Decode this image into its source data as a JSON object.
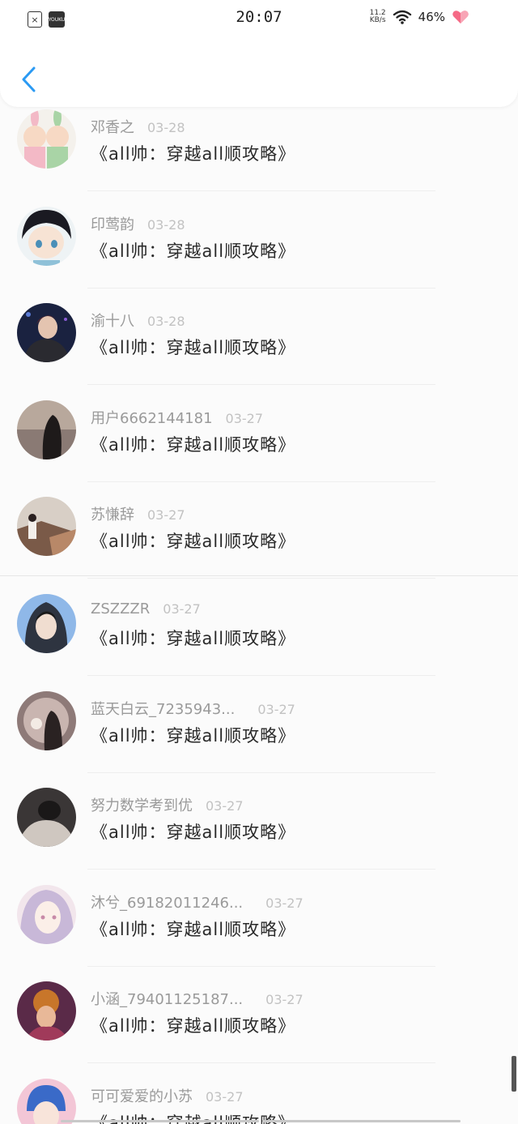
{
  "status_bar": {
    "time": "20:07",
    "net_speed_value": "11.2",
    "net_speed_unit": "KB/s",
    "battery": "46%",
    "youku_label": "YOUKU",
    "sim_glyph": "×"
  },
  "header": {
    "back_icon": "chevron-left-icon",
    "accent_color": "#2b9af3"
  },
  "comments": [
    {
      "user": "邓香之",
      "date": "03-28",
      "text": "《all帅：穿越all顺攻略》"
    },
    {
      "user": "印莺韵",
      "date": "03-28",
      "text": "《all帅：穿越all顺攻略》"
    },
    {
      "user": "渝十八",
      "date": "03-28",
      "text": "《all帅：穿越all顺攻略》"
    },
    {
      "user": "用户6662144181",
      "date": "03-27",
      "text": "《all帅：穿越all顺攻略》"
    },
    {
      "user": "苏慊辞",
      "date": "03-27",
      "text": "《all帅：穿越all顺攻略》"
    },
    {
      "user": "ZSZZZR",
      "date": "03-27",
      "text": "《all帅：穿越all顺攻略》"
    },
    {
      "user": "蓝天白云_7235943...",
      "date": "03-27",
      "text": "《all帅：穿越all顺攻略》"
    },
    {
      "user": "努力数学考到优",
      "date": "03-27",
      "text": "《all帅：穿越all顺攻略》"
    },
    {
      "user": "沐兮_69182011246...",
      "date": "03-27",
      "text": "《all帅：穿越all顺攻略》"
    },
    {
      "user": "小涵_79401125187...",
      "date": "03-27",
      "text": "《all帅：穿越all顺攻略》"
    },
    {
      "user": "可可爱爱的小苏",
      "date": "03-27",
      "text": "《all帅：穿越all顺攻略》"
    }
  ]
}
